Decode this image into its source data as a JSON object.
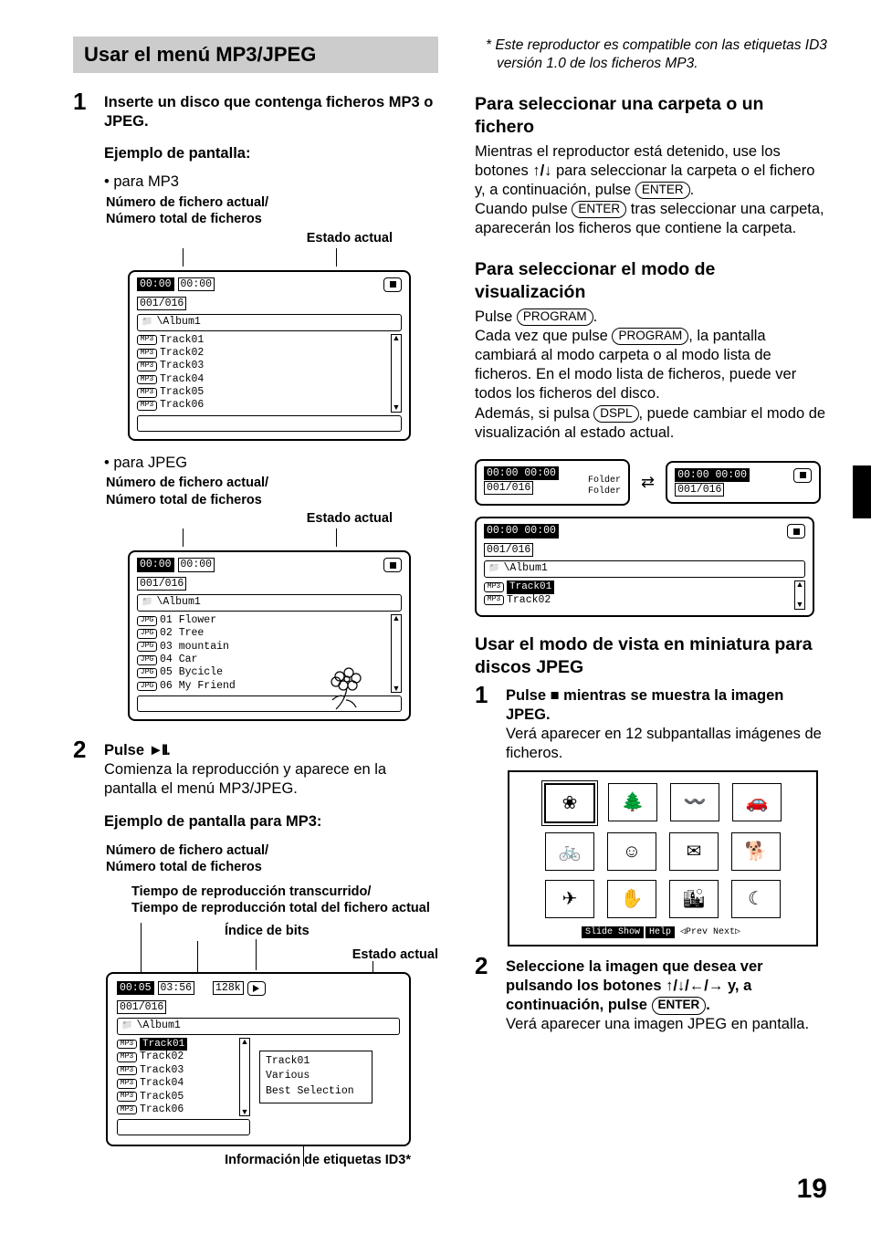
{
  "left": {
    "section_title": "Usar el menú MP3/JPEG",
    "step1": "Inserte un disco que contenga ficheros MP3 o JPEG.",
    "example_screen": "Ejemplo de pantalla:",
    "bullet_mp3": "para MP3",
    "bullet_jpeg": "para JPEG",
    "label_filecount": "Número de fichero actual/\nNúmero total de ficheros",
    "label_estado": "Estado actual",
    "step2_lead": "Pulse ",
    "step2_icon": "►II",
    "step2_tail": ".",
    "step2_body": "Comienza la reproducción y aparece en la pantalla el menú MP3/JPEG.",
    "example_mp3": "Ejemplo de pantalla para MP3:",
    "label_elapsed": "Tiempo de reproducción transcurrido/\nTiempo de reproducción total del fichero actual",
    "label_bitrate": "Índice de bits",
    "label_id3": "Información de etiquetas ID3*"
  },
  "mp3screen": {
    "time_cur": "00:00",
    "time_tot": "00:00",
    "count": "001/016",
    "folder": "\\Album1",
    "tracks": [
      "Track01",
      "Track02",
      "Track03",
      "Track04",
      "Track05",
      "Track06"
    ]
  },
  "jpegscreen": {
    "time_cur": "00:00",
    "time_tot": "00:00",
    "count": "001/016",
    "folder": "\\Album1",
    "items": [
      "01 Flower",
      "02 Tree",
      "03 mountain",
      "04 Car",
      "05 Bycicle",
      "06 My Friend"
    ]
  },
  "bigscreen": {
    "time_cur": "00:05",
    "time_tot": "03:56",
    "bitrate": "128k",
    "count": "001/016",
    "folder": "\\Album1",
    "tracks": [
      "Track01",
      "Track02",
      "Track03",
      "Track04",
      "Track05",
      "Track06"
    ],
    "id3": [
      "Track01",
      "Various",
      "Best Selection"
    ]
  },
  "right": {
    "note": "* Este reproductor es compatible con las etiquetas ID3 versión 1.0 de los ficheros MP3.",
    "h_select": "Para seleccionar una carpeta o un fichero",
    "p_select_1a": "Mientras el reproductor está detenido, use los botones ",
    "arrows_ud": "↑/↓",
    "p_select_1b": " para seleccionar la carpeta o el fichero y, a continuación, pulse ",
    "enter": "ENTER",
    "p_select_1c": ".",
    "p_select_2a": "Cuando pulse ",
    "p_select_2b": " tras seleccionar una carpeta, aparecerán los ficheros que contiene la carpeta.",
    "h_mode": "Para seleccionar el modo de visualización",
    "p_mode_1a": "Pulse ",
    "program": "PROGRAM",
    "p_mode_1b": ".",
    "p_mode_2a": "Cada vez que pulse ",
    "p_mode_2b": ", la pantalla cambiará al modo carpeta o al modo lista de ficheros. En el modo lista de ficheros, puede ver todos los ficheros del disco.",
    "p_mode_3a": "Además, si pulsa ",
    "dspl": "DSPL",
    "p_mode_3b": ", puede cambiar el modo de visualización al estado actual.",
    "h_thumb": "Usar el modo de vista en miniatura para discos JPEG",
    "step1_lead": "Pulse ",
    "step1_icon": "■",
    "step1_tail": " mientras se muestra la imagen JPEG.",
    "step1_body": "Verá aparecer en 12 subpantallas imágenes de ficheros.",
    "step2_a": "Seleccione la imagen que desea ver pulsando los botones ",
    "arrows4": "↑/↓/←/→",
    "step2_b": " y, a continuación, pulse ",
    "step2_c": ".",
    "step2_body": "Verá aparecer una imagen JPEG en pantalla."
  },
  "widescreens": {
    "left": {
      "l1": "00:00  00:00",
      "l2": "001/016",
      "r1": "Folder",
      "r2": "Folder"
    },
    "right": {
      "l1": "00:00  00:00",
      "l2": "001/016"
    },
    "lower": {
      "l1": "00:00  00:00",
      "l2": "001/016",
      "folder": "\\Album1",
      "tracks": [
        "Track01",
        "Track02"
      ]
    }
  },
  "thumbfoot": {
    "a": "Slide Show",
    "b": "Help",
    "c": "◁Prev Next▷"
  },
  "pagenum": "19"
}
